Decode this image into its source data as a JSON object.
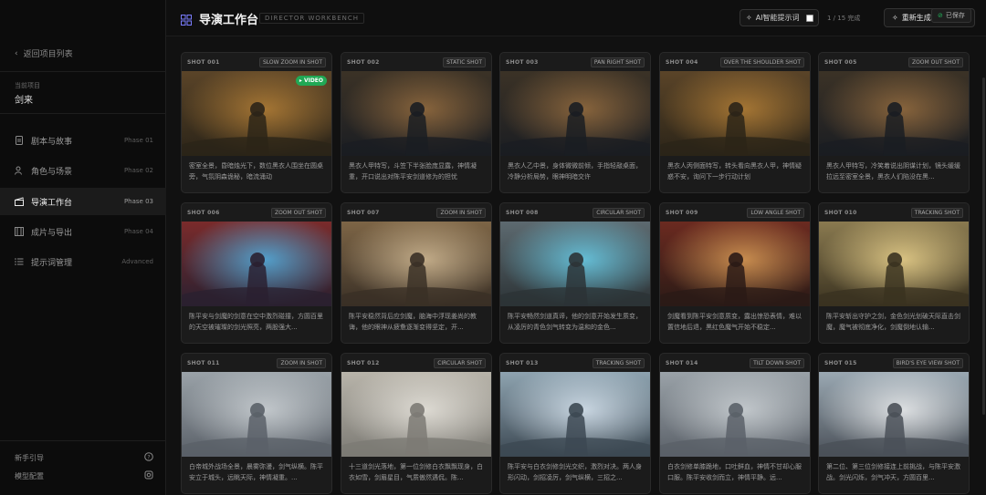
{
  "sidebar": {
    "back_label": "返回项目列表",
    "current_label": "当前项目",
    "project_name": "剑来",
    "nav": [
      {
        "label": "剧本与故事",
        "phase": "Phase 01",
        "icon": "document-icon"
      },
      {
        "label": "角色与场景",
        "phase": "Phase 02",
        "icon": "users-icon"
      },
      {
        "label": "导演工作台",
        "phase": "Phase 03",
        "icon": "clapper-icon"
      },
      {
        "label": "成片与导出",
        "phase": "Phase 04",
        "icon": "film-icon"
      },
      {
        "label": "提示词管理",
        "phase": "Advanced",
        "icon": "list-icon"
      }
    ],
    "bottom": [
      {
        "label": "新手引导",
        "icon": "help-icon"
      },
      {
        "label": "模型配置",
        "icon": "settings-icon"
      }
    ]
  },
  "header": {
    "title": "导演工作台",
    "subtitle": "DIRECTOR WORKBENCH",
    "ai_toggle_label": "AI智能提示词",
    "progress": "1 / 15 完成",
    "regen_label": "重新生成",
    "saved_label": "已保存"
  },
  "shots": [
    {
      "id": "SHOT 001",
      "type": "SLOW ZOOM IN SHOT",
      "desc": "密室全景，昏暗烛光下，数位黑衣人围坐在圆桌旁，气氛阴森诡秘，暗流涌动",
      "video": "VIDEO",
      "scene": "room"
    },
    {
      "id": "SHOT 002",
      "type": "STATIC SHOT",
      "desc": "黑衣人甲特写，斗笠下半张脸庞显露，神情凝重，开口说出对陈平安剑道修为的担忧",
      "scene": "hat"
    },
    {
      "id": "SHOT 003",
      "type": "PAN RIGHT SHOT",
      "desc": "黑衣人乙中景，身体微微前倾，手指轻敲桌面，冷静分析局势，眼神明暗交许",
      "scene": "hat"
    },
    {
      "id": "SHOT 004",
      "type": "OVER THE SHOULDER SHOT",
      "desc": "黑衣人丙侧面特写，转头看向黑衣人甲，神情疑惑不安，询问下一步行动计划",
      "scene": "room"
    },
    {
      "id": "SHOT 005",
      "type": "ZOOM OUT SHOT",
      "desc": "黑衣人甲特写，冷笑着说出阴谋计划，镜头缓缓拉远至密室全景，黑衣人们陷没在黑...",
      "scene": "hat"
    },
    {
      "id": "SHOT 006",
      "type": "ZOOM OUT SHOT",
      "desc": "陈平安与剑魔的剑意在空中激烈碰撞，方圆百里的天空被璀璨的剑光照亮，两股强大...",
      "scene": "clash"
    },
    {
      "id": "SHOT 007",
      "type": "ZOOM IN SHOT",
      "desc": "陈平安稳然背后应剑魔，脑海中浮现姜尚的教诲，他的眼神从疲惫逐渐变得坚定，开...",
      "scene": "warrior"
    },
    {
      "id": "SHOT 008",
      "type": "CIRCULAR SHOT",
      "desc": "陈平安畅然剑道真谛，他的剑意开始发生质变，从凌厉的青色剑气转变为温和的金色...",
      "scene": "battle"
    },
    {
      "id": "SHOT 009",
      "type": "LOW ANGLE SHOT",
      "desc": "剑魔看到陈平安剑意质变，露出惊恐表情，难以置信地后退，黑红色魔气开始不稳定...",
      "scene": "demon"
    },
    {
      "id": "SHOT 010",
      "type": "TRACKING SHOT",
      "desc": "陈平安斩出守护之剑，金色剑光划破天际直击剑魔，魔气被彻底净化，剑魔倒地认输...",
      "scene": "light"
    },
    {
      "id": "SHOT 011",
      "type": "ZOOM IN SHOT",
      "desc": "白帝城外战场全景，晨雾弥漫，剑气纵横。陈平安立于城头，远眺天际，神情凝重。...",
      "scene": "ruin"
    },
    {
      "id": "SHOT 012",
      "type": "CIRCULAR SHOT",
      "desc": "十三道剑光落地，第一位剑修白衣飘飘现身，白衣如雪，剑眉星目，气质傲然遇侃。陈...",
      "scene": "white"
    },
    {
      "id": "SHOT 013",
      "type": "TRACKING SHOT",
      "desc": "陈平安与白衣剑修剑光交织，激烈对决。两人身形闪动，剑招凌厉，剑气纵横，三招之...",
      "scene": "duel"
    },
    {
      "id": "SHOT 014",
      "type": "TILT DOWN SHOT",
      "desc": "白衣剑修单膝跪地，口吐鲜血，神情不甘却心服口服。陈平安收剑而立，神情平静。远...",
      "scene": "ruin"
    },
    {
      "id": "SHOT 015",
      "type": "BIRD'S EYE VIEW SHOT",
      "desc": "第二位、第三位剑修接连上前挑战，与陈平安激战。剑光闪烁，剑气冲天，方圆百里...",
      "scene": "burst"
    }
  ]
}
